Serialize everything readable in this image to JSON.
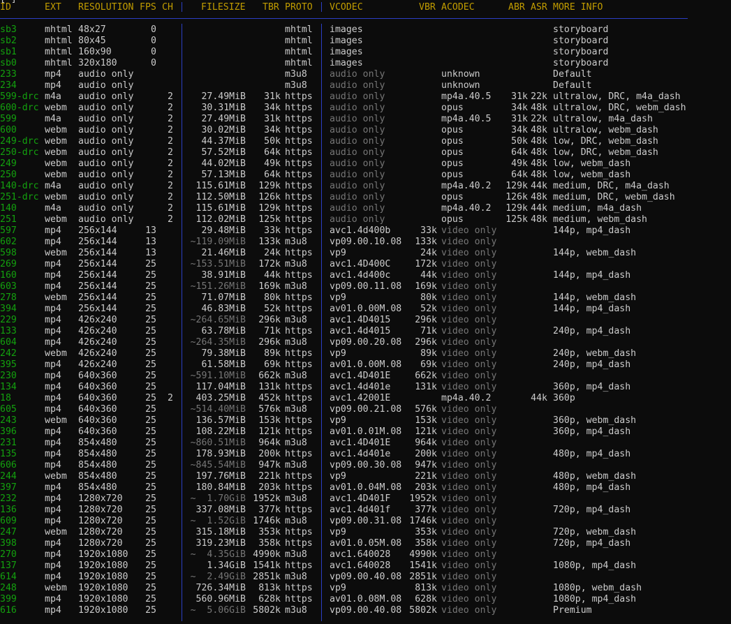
{
  "columns": {
    "id": "ID",
    "ext": "EXT",
    "resolution": "RESOLUTION",
    "fps": "FPS",
    "ch": "CH",
    "filesize": "FILESIZE",
    "tbr": "TBR",
    "proto": "PROTO",
    "vcodec": "VCODEC",
    "vbr": "VBR",
    "acodec": "ACODEC",
    "abr": "ABR",
    "asr": "ASR",
    "more_info": "MORE INFO"
  },
  "colors": {
    "background": "#0c0c0c",
    "text": "#cccccc",
    "header": "#c19c00",
    "id": "#13a10e",
    "dim": "#767676",
    "separator": "#2b3fc4"
  },
  "rows": [
    {
      "id": "sb3",
      "ext": "mhtml",
      "res": "48x27",
      "fps": "0",
      "ch": "",
      "size": "",
      "tbr": "",
      "proto": "mhtml",
      "vcodec": "images",
      "vbr": "",
      "acodec": "",
      "abr": "",
      "asr": "",
      "info": "storyboard"
    },
    {
      "id": "sb2",
      "ext": "mhtml",
      "res": "80x45",
      "fps": "0",
      "ch": "",
      "size": "",
      "tbr": "",
      "proto": "mhtml",
      "vcodec": "images",
      "vbr": "",
      "acodec": "",
      "abr": "",
      "asr": "",
      "info": "storyboard"
    },
    {
      "id": "sb1",
      "ext": "mhtml",
      "res": "160x90",
      "fps": "0",
      "ch": "",
      "size": "",
      "tbr": "",
      "proto": "mhtml",
      "vcodec": "images",
      "vbr": "",
      "acodec": "",
      "abr": "",
      "asr": "",
      "info": "storyboard"
    },
    {
      "id": "sb0",
      "ext": "mhtml",
      "res": "320x180",
      "fps": "0",
      "ch": "",
      "size": "",
      "tbr": "",
      "proto": "mhtml",
      "vcodec": "images",
      "vbr": "",
      "acodec": "",
      "abr": "",
      "asr": "",
      "info": "storyboard"
    },
    {
      "id": "233",
      "ext": "mp4",
      "res": "audio only",
      "fps": "",
      "ch": "",
      "size": "",
      "tbr": "",
      "proto": "m3u8",
      "vcodec": "audio only",
      "vbr": "",
      "acodec": "unknown",
      "abr": "",
      "asr": "",
      "info": "Default"
    },
    {
      "id": "234",
      "ext": "mp4",
      "res": "audio only",
      "fps": "",
      "ch": "",
      "size": "",
      "tbr": "",
      "proto": "m3u8",
      "vcodec": "audio only",
      "vbr": "",
      "acodec": "unknown",
      "abr": "",
      "asr": "",
      "info": "Default"
    },
    {
      "id": "599-drc",
      "ext": "m4a",
      "res": "audio only",
      "fps": "",
      "ch": "2",
      "size": "27.49MiB",
      "tbr": "31k",
      "proto": "https",
      "vcodec": "audio only",
      "vbr": "",
      "acodec": "mp4a.40.5",
      "abr": "31k",
      "asr": "22k",
      "info": "ultralow, DRC, m4a_dash"
    },
    {
      "id": "600-drc",
      "ext": "webm",
      "res": "audio only",
      "fps": "",
      "ch": "2",
      "size": "30.31MiB",
      "tbr": "34k",
      "proto": "https",
      "vcodec": "audio only",
      "vbr": "",
      "acodec": "opus",
      "abr": "34k",
      "asr": "48k",
      "info": "ultralow, DRC, webm_dash"
    },
    {
      "id": "599",
      "ext": "m4a",
      "res": "audio only",
      "fps": "",
      "ch": "2",
      "size": "27.49MiB",
      "tbr": "31k",
      "proto": "https",
      "vcodec": "audio only",
      "vbr": "",
      "acodec": "mp4a.40.5",
      "abr": "31k",
      "asr": "22k",
      "info": "ultralow, m4a_dash"
    },
    {
      "id": "600",
      "ext": "webm",
      "res": "audio only",
      "fps": "",
      "ch": "2",
      "size": "30.02MiB",
      "tbr": "34k",
      "proto": "https",
      "vcodec": "audio only",
      "vbr": "",
      "acodec": "opus",
      "abr": "34k",
      "asr": "48k",
      "info": "ultralow, webm_dash"
    },
    {
      "id": "249-drc",
      "ext": "webm",
      "res": "audio only",
      "fps": "",
      "ch": "2",
      "size": "44.37MiB",
      "tbr": "50k",
      "proto": "https",
      "vcodec": "audio only",
      "vbr": "",
      "acodec": "opus",
      "abr": "50k",
      "asr": "48k",
      "info": "low, DRC, webm_dash"
    },
    {
      "id": "250-drc",
      "ext": "webm",
      "res": "audio only",
      "fps": "",
      "ch": "2",
      "size": "57.52MiB",
      "tbr": "64k",
      "proto": "https",
      "vcodec": "audio only",
      "vbr": "",
      "acodec": "opus",
      "abr": "64k",
      "asr": "48k",
      "info": "low, DRC, webm_dash"
    },
    {
      "id": "249",
      "ext": "webm",
      "res": "audio only",
      "fps": "",
      "ch": "2",
      "size": "44.02MiB",
      "tbr": "49k",
      "proto": "https",
      "vcodec": "audio only",
      "vbr": "",
      "acodec": "opus",
      "abr": "49k",
      "asr": "48k",
      "info": "low, webm_dash"
    },
    {
      "id": "250",
      "ext": "webm",
      "res": "audio only",
      "fps": "",
      "ch": "2",
      "size": "57.13MiB",
      "tbr": "64k",
      "proto": "https",
      "vcodec": "audio only",
      "vbr": "",
      "acodec": "opus",
      "abr": "64k",
      "asr": "48k",
      "info": "low, webm_dash"
    },
    {
      "id": "140-drc",
      "ext": "m4a",
      "res": "audio only",
      "fps": "",
      "ch": "2",
      "size": "115.61MiB",
      "tbr": "129k",
      "proto": "https",
      "vcodec": "audio only",
      "vbr": "",
      "acodec": "mp4a.40.2",
      "abr": "129k",
      "asr": "44k",
      "info": "medium, DRC, m4a_dash"
    },
    {
      "id": "251-drc",
      "ext": "webm",
      "res": "audio only",
      "fps": "",
      "ch": "2",
      "size": "112.50MiB",
      "tbr": "126k",
      "proto": "https",
      "vcodec": "audio only",
      "vbr": "",
      "acodec": "opus",
      "abr": "126k",
      "asr": "48k",
      "info": "medium, DRC, webm_dash"
    },
    {
      "id": "140",
      "ext": "m4a",
      "res": "audio only",
      "fps": "",
      "ch": "2",
      "size": "115.61MiB",
      "tbr": "129k",
      "proto": "https",
      "vcodec": "audio only",
      "vbr": "",
      "acodec": "mp4a.40.2",
      "abr": "129k",
      "asr": "44k",
      "info": "medium, m4a_dash"
    },
    {
      "id": "251",
      "ext": "webm",
      "res": "audio only",
      "fps": "",
      "ch": "2",
      "size": "112.02MiB",
      "tbr": "125k",
      "proto": "https",
      "vcodec": "audio only",
      "vbr": "",
      "acodec": "opus",
      "abr": "125k",
      "asr": "48k",
      "info": "medium, webm_dash"
    },
    {
      "id": "597",
      "ext": "mp4",
      "res": "256x144",
      "fps": "13",
      "ch": "",
      "size": "29.48MiB",
      "tbr": "33k",
      "proto": "https",
      "vcodec": "avc1.4d400b",
      "vbr": "33k",
      "acodec": "video only",
      "abr": "",
      "asr": "",
      "info": "144p, mp4_dash"
    },
    {
      "id": "602",
      "ext": "mp4",
      "res": "256x144",
      "fps": "13",
      "ch": "",
      "size": "~119.09MiB",
      "tbr": "133k",
      "proto": "m3u8",
      "vcodec": "vp09.00.10.08",
      "vbr": "133k",
      "acodec": "video only",
      "abr": "",
      "asr": "",
      "info": ""
    },
    {
      "id": "598",
      "ext": "webm",
      "res": "256x144",
      "fps": "13",
      "ch": "",
      "size": "21.46MiB",
      "tbr": "24k",
      "proto": "https",
      "vcodec": "vp9",
      "vbr": "24k",
      "acodec": "video only",
      "abr": "",
      "asr": "",
      "info": "144p, webm_dash"
    },
    {
      "id": "269",
      "ext": "mp4",
      "res": "256x144",
      "fps": "25",
      "ch": "",
      "size": "~153.51MiB",
      "tbr": "172k",
      "proto": "m3u8",
      "vcodec": "avc1.4D400C",
      "vbr": "172k",
      "acodec": "video only",
      "abr": "",
      "asr": "",
      "info": ""
    },
    {
      "id": "160",
      "ext": "mp4",
      "res": "256x144",
      "fps": "25",
      "ch": "",
      "size": "38.91MiB",
      "tbr": "44k",
      "proto": "https",
      "vcodec": "avc1.4d400c",
      "vbr": "44k",
      "acodec": "video only",
      "abr": "",
      "asr": "",
      "info": "144p, mp4_dash"
    },
    {
      "id": "603",
      "ext": "mp4",
      "res": "256x144",
      "fps": "25",
      "ch": "",
      "size": "~151.26MiB",
      "tbr": "169k",
      "proto": "m3u8",
      "vcodec": "vp09.00.11.08",
      "vbr": "169k",
      "acodec": "video only",
      "abr": "",
      "asr": "",
      "info": ""
    },
    {
      "id": "278",
      "ext": "webm",
      "res": "256x144",
      "fps": "25",
      "ch": "",
      "size": "71.07MiB",
      "tbr": "80k",
      "proto": "https",
      "vcodec": "vp9",
      "vbr": "80k",
      "acodec": "video only",
      "abr": "",
      "asr": "",
      "info": "144p, webm_dash"
    },
    {
      "id": "394",
      "ext": "mp4",
      "res": "256x144",
      "fps": "25",
      "ch": "",
      "size": "46.83MiB",
      "tbr": "52k",
      "proto": "https",
      "vcodec": "av01.0.00M.08",
      "vbr": "52k",
      "acodec": "video only",
      "abr": "",
      "asr": "",
      "info": "144p, mp4_dash"
    },
    {
      "id": "229",
      "ext": "mp4",
      "res": "426x240",
      "fps": "25",
      "ch": "",
      "size": "~264.65MiB",
      "tbr": "296k",
      "proto": "m3u8",
      "vcodec": "avc1.4D4015",
      "vbr": "296k",
      "acodec": "video only",
      "abr": "",
      "asr": "",
      "info": ""
    },
    {
      "id": "133",
      "ext": "mp4",
      "res": "426x240",
      "fps": "25",
      "ch": "",
      "size": "63.78MiB",
      "tbr": "71k",
      "proto": "https",
      "vcodec": "avc1.4d4015",
      "vbr": "71k",
      "acodec": "video only",
      "abr": "",
      "asr": "",
      "info": "240p, mp4_dash"
    },
    {
      "id": "604",
      "ext": "mp4",
      "res": "426x240",
      "fps": "25",
      "ch": "",
      "size": "~264.35MiB",
      "tbr": "296k",
      "proto": "m3u8",
      "vcodec": "vp09.00.20.08",
      "vbr": "296k",
      "acodec": "video only",
      "abr": "",
      "asr": "",
      "info": ""
    },
    {
      "id": "242",
      "ext": "webm",
      "res": "426x240",
      "fps": "25",
      "ch": "",
      "size": "79.38MiB",
      "tbr": "89k",
      "proto": "https",
      "vcodec": "vp9",
      "vbr": "89k",
      "acodec": "video only",
      "abr": "",
      "asr": "",
      "info": "240p, webm_dash"
    },
    {
      "id": "395",
      "ext": "mp4",
      "res": "426x240",
      "fps": "25",
      "ch": "",
      "size": "61.58MiB",
      "tbr": "69k",
      "proto": "https",
      "vcodec": "av01.0.00M.08",
      "vbr": "69k",
      "acodec": "video only",
      "abr": "",
      "asr": "",
      "info": "240p, mp4_dash"
    },
    {
      "id": "230",
      "ext": "mp4",
      "res": "640x360",
      "fps": "25",
      "ch": "",
      "size": "~591.10MiB",
      "tbr": "662k",
      "proto": "m3u8",
      "vcodec": "avc1.4D401E",
      "vbr": "662k",
      "acodec": "video only",
      "abr": "",
      "asr": "",
      "info": ""
    },
    {
      "id": "134",
      "ext": "mp4",
      "res": "640x360",
      "fps": "25",
      "ch": "",
      "size": "117.04MiB",
      "tbr": "131k",
      "proto": "https",
      "vcodec": "avc1.4d401e",
      "vbr": "131k",
      "acodec": "video only",
      "abr": "",
      "asr": "",
      "info": "360p, mp4_dash"
    },
    {
      "id": "18",
      "ext": "mp4",
      "res": "640x360",
      "fps": "25",
      "ch": "2",
      "size": "403.25MiB",
      "tbr": "452k",
      "proto": "https",
      "vcodec": "avc1.42001E",
      "vbr": "",
      "acodec": "mp4a.40.2",
      "abr": "",
      "asr": "44k",
      "info": "360p"
    },
    {
      "id": "605",
      "ext": "mp4",
      "res": "640x360",
      "fps": "25",
      "ch": "",
      "size": "~514.40MiB",
      "tbr": "576k",
      "proto": "m3u8",
      "vcodec": "vp09.00.21.08",
      "vbr": "576k",
      "acodec": "video only",
      "abr": "",
      "asr": "",
      "info": ""
    },
    {
      "id": "243",
      "ext": "webm",
      "res": "640x360",
      "fps": "25",
      "ch": "",
      "size": "136.57MiB",
      "tbr": "153k",
      "proto": "https",
      "vcodec": "vp9",
      "vbr": "153k",
      "acodec": "video only",
      "abr": "",
      "asr": "",
      "info": "360p, webm_dash"
    },
    {
      "id": "396",
      "ext": "mp4",
      "res": "640x360",
      "fps": "25",
      "ch": "",
      "size": "108.22MiB",
      "tbr": "121k",
      "proto": "https",
      "vcodec": "av01.0.01M.08",
      "vbr": "121k",
      "acodec": "video only",
      "abr": "",
      "asr": "",
      "info": "360p, mp4_dash"
    },
    {
      "id": "231",
      "ext": "mp4",
      "res": "854x480",
      "fps": "25",
      "ch": "",
      "size": "~860.51MiB",
      "tbr": "964k",
      "proto": "m3u8",
      "vcodec": "avc1.4D401E",
      "vbr": "964k",
      "acodec": "video only",
      "abr": "",
      "asr": "",
      "info": ""
    },
    {
      "id": "135",
      "ext": "mp4",
      "res": "854x480",
      "fps": "25",
      "ch": "",
      "size": "178.93MiB",
      "tbr": "200k",
      "proto": "https",
      "vcodec": "avc1.4d401e",
      "vbr": "200k",
      "acodec": "video only",
      "abr": "",
      "asr": "",
      "info": "480p, mp4_dash"
    },
    {
      "id": "606",
      "ext": "mp4",
      "res": "854x480",
      "fps": "25",
      "ch": "",
      "size": "~845.54MiB",
      "tbr": "947k",
      "proto": "m3u8",
      "vcodec": "vp09.00.30.08",
      "vbr": "947k",
      "acodec": "video only",
      "abr": "",
      "asr": "",
      "info": ""
    },
    {
      "id": "244",
      "ext": "webm",
      "res": "854x480",
      "fps": "25",
      "ch": "",
      "size": "197.76MiB",
      "tbr": "221k",
      "proto": "https",
      "vcodec": "vp9",
      "vbr": "221k",
      "acodec": "video only",
      "abr": "",
      "asr": "",
      "info": "480p, webm_dash"
    },
    {
      "id": "397",
      "ext": "mp4",
      "res": "854x480",
      "fps": "25",
      "ch": "",
      "size": "180.84MiB",
      "tbr": "203k",
      "proto": "https",
      "vcodec": "av01.0.04M.08",
      "vbr": "203k",
      "acodec": "video only",
      "abr": "",
      "asr": "",
      "info": "480p, mp4_dash"
    },
    {
      "id": "232",
      "ext": "mp4",
      "res": "1280x720",
      "fps": "25",
      "ch": "",
      "size": "~  1.70GiB",
      "tbr": "1952k",
      "proto": "m3u8",
      "vcodec": "avc1.4D401F",
      "vbr": "1952k",
      "acodec": "video only",
      "abr": "",
      "asr": "",
      "info": ""
    },
    {
      "id": "136",
      "ext": "mp4",
      "res": "1280x720",
      "fps": "25",
      "ch": "",
      "size": "337.08MiB",
      "tbr": "377k",
      "proto": "https",
      "vcodec": "avc1.4d401f",
      "vbr": "377k",
      "acodec": "video only",
      "abr": "",
      "asr": "",
      "info": "720p, mp4_dash"
    },
    {
      "id": "609",
      "ext": "mp4",
      "res": "1280x720",
      "fps": "25",
      "ch": "",
      "size": "~  1.52GiB",
      "tbr": "1746k",
      "proto": "m3u8",
      "vcodec": "vp09.00.31.08",
      "vbr": "1746k",
      "acodec": "video only",
      "abr": "",
      "asr": "",
      "info": ""
    },
    {
      "id": "247",
      "ext": "webm",
      "res": "1280x720",
      "fps": "25",
      "ch": "",
      "size": "315.18MiB",
      "tbr": "353k",
      "proto": "https",
      "vcodec": "vp9",
      "vbr": "353k",
      "acodec": "video only",
      "abr": "",
      "asr": "",
      "info": "720p, webm_dash"
    },
    {
      "id": "398",
      "ext": "mp4",
      "res": "1280x720",
      "fps": "25",
      "ch": "",
      "size": "319.23MiB",
      "tbr": "358k",
      "proto": "https",
      "vcodec": "av01.0.05M.08",
      "vbr": "358k",
      "acodec": "video only",
      "abr": "",
      "asr": "",
      "info": "720p, mp4_dash"
    },
    {
      "id": "270",
      "ext": "mp4",
      "res": "1920x1080",
      "fps": "25",
      "ch": "",
      "size": "~  4.35GiB",
      "tbr": "4990k",
      "proto": "m3u8",
      "vcodec": "avc1.640028",
      "vbr": "4990k",
      "acodec": "video only",
      "abr": "",
      "asr": "",
      "info": ""
    },
    {
      "id": "137",
      "ext": "mp4",
      "res": "1920x1080",
      "fps": "25",
      "ch": "",
      "size": "1.34GiB",
      "tbr": "1541k",
      "proto": "https",
      "vcodec": "avc1.640028",
      "vbr": "1541k",
      "acodec": "video only",
      "abr": "",
      "asr": "",
      "info": "1080p, mp4_dash"
    },
    {
      "id": "614",
      "ext": "mp4",
      "res": "1920x1080",
      "fps": "25",
      "ch": "",
      "size": "~  2.49GiB",
      "tbr": "2851k",
      "proto": "m3u8",
      "vcodec": "vp09.00.40.08",
      "vbr": "2851k",
      "acodec": "video only",
      "abr": "",
      "asr": "",
      "info": ""
    },
    {
      "id": "248",
      "ext": "webm",
      "res": "1920x1080",
      "fps": "25",
      "ch": "",
      "size": "726.34MiB",
      "tbr": "813k",
      "proto": "https",
      "vcodec": "vp9",
      "vbr": "813k",
      "acodec": "video only",
      "abr": "",
      "asr": "",
      "info": "1080p, webm_dash"
    },
    {
      "id": "399",
      "ext": "mp4",
      "res": "1920x1080",
      "fps": "25",
      "ch": "",
      "size": "560.96MiB",
      "tbr": "628k",
      "proto": "https",
      "vcodec": "av01.0.08M.08",
      "vbr": "628k",
      "acodec": "video only",
      "abr": "",
      "asr": "",
      "info": "1080p, mp4_dash"
    },
    {
      "id": "616",
      "ext": "mp4",
      "res": "1920x1080",
      "fps": "25",
      "ch": "",
      "size": "~  5.06GiB",
      "tbr": "5802k",
      "proto": "m3u8",
      "vcodec": "vp09.00.40.08",
      "vbr": "5802k",
      "acodec": "video only",
      "abr": "",
      "asr": "",
      "info": "Premium"
    }
  ]
}
